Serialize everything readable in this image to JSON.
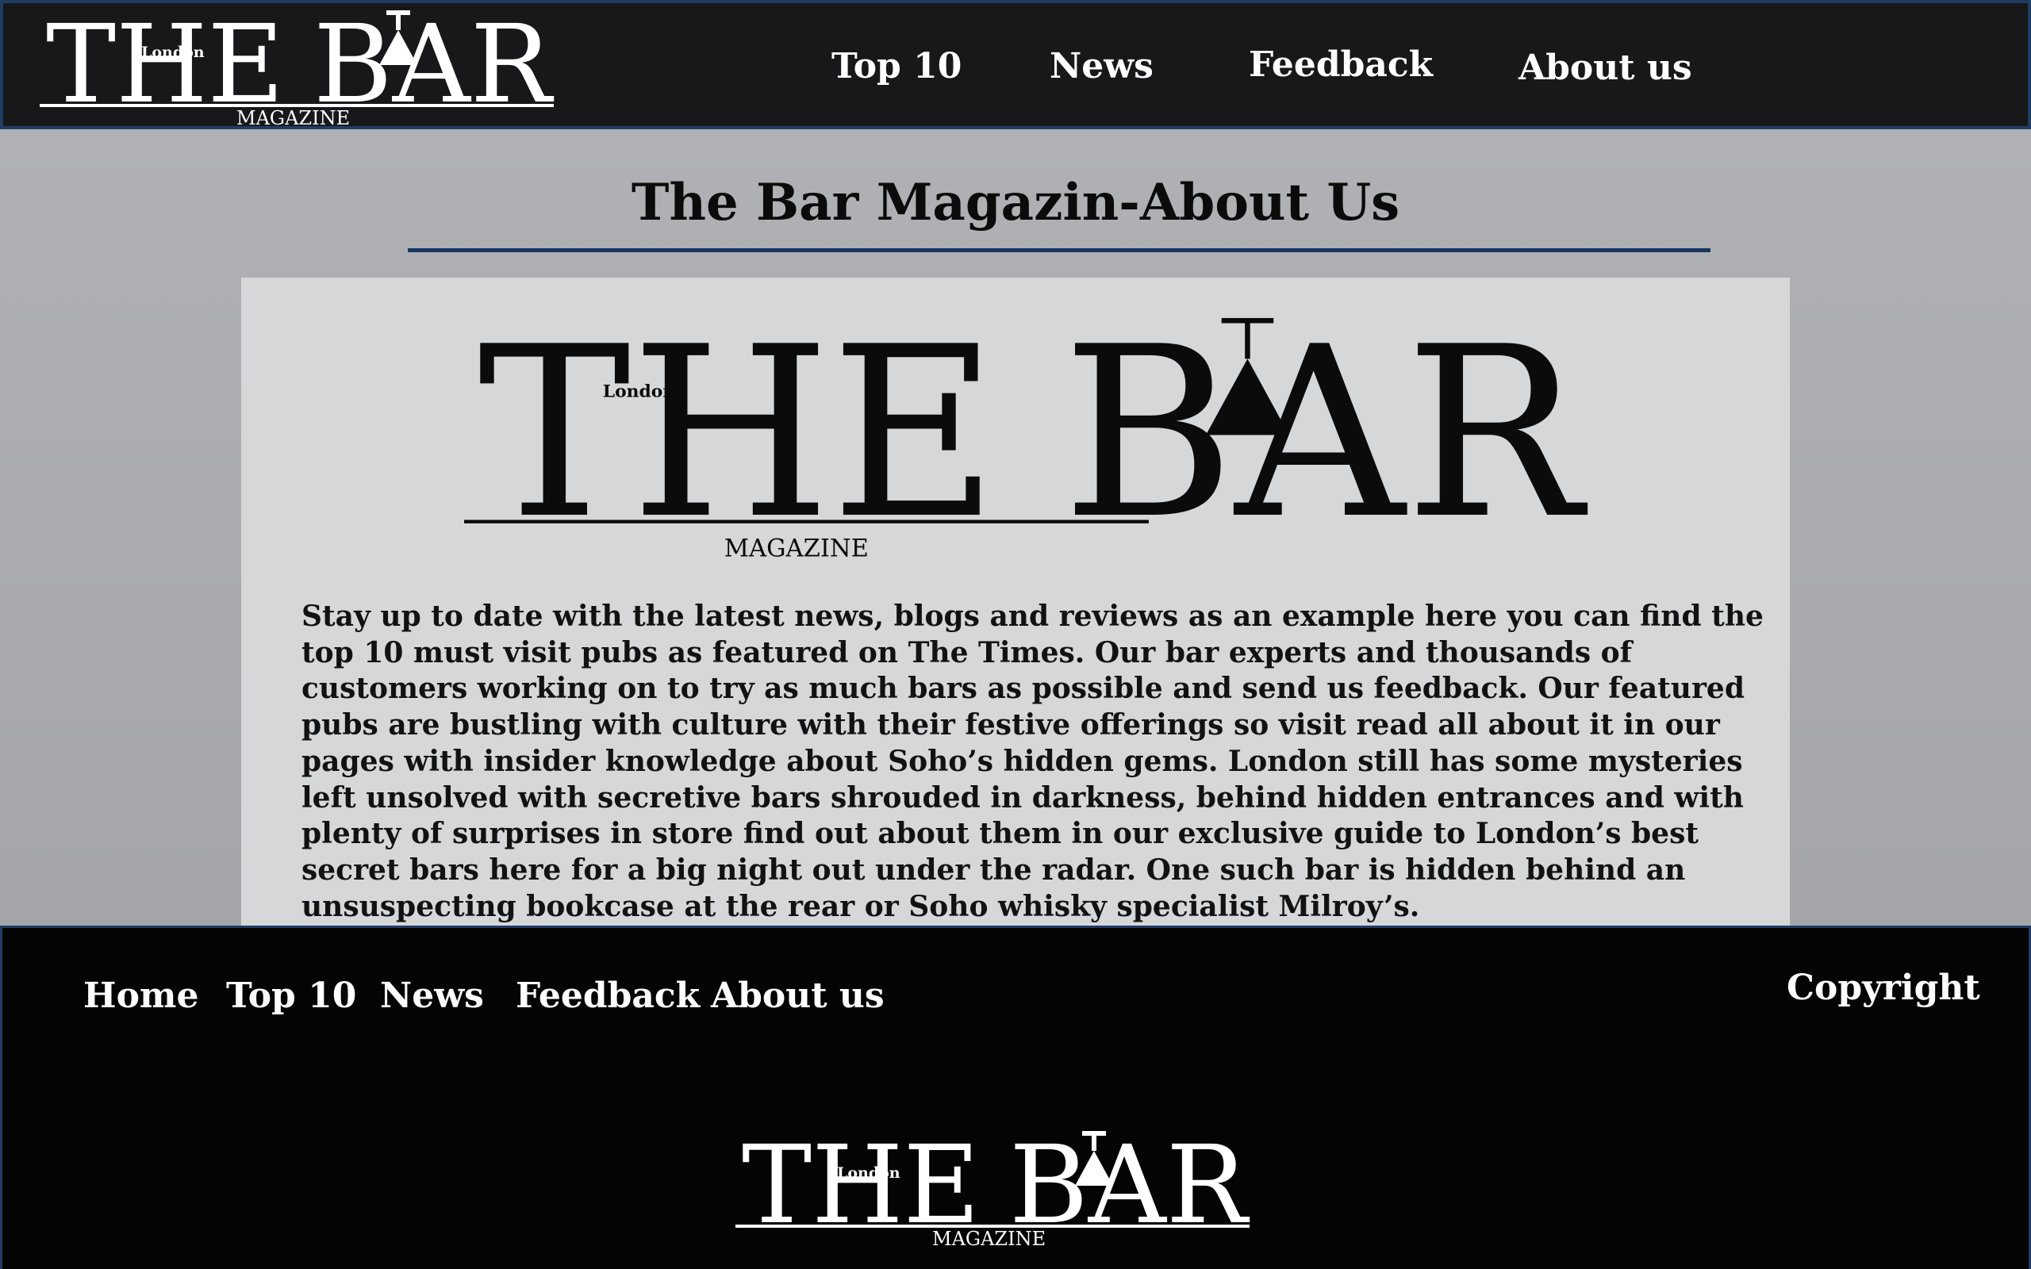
{
  "brand": {
    "name_the": "THE",
    "name_bar": "BAR",
    "tagline_city": "London",
    "tagline_magazine": "MAGAZINE"
  },
  "header": {
    "nav": [
      {
        "label": "Top 10"
      },
      {
        "label": "News"
      },
      {
        "label": "Feedback"
      },
      {
        "label": "About us"
      }
    ]
  },
  "main": {
    "title": "The Bar Magazin-About Us",
    "body": "Stay up to date with the latest news, blogs and reviews as an example here you can find the top 10 must visit pubs as featured on The Times. Our bar experts and thousands of customers working on to try as much bars as possible and send us feedback. Our featured pubs are bustling with culture with their festive offerings so visit read all about it in our pages with insider knowledge about Soho’s hidden gems. London still has some mysteries left unsolved with secretive bars shrouded in darkness, behind hidden entrances and with plenty of surprises in store find out about them in our exclusive guide to London’s best secret bars here for a big night out under the radar. One such bar is hidden behind an unsuspecting bookcase at the rear or Soho whisky specialist Milroy’s."
  },
  "footer": {
    "nav": [
      {
        "label": "Home"
      },
      {
        "label": "Top 10"
      },
      {
        "label": "News"
      },
      {
        "label": "Feedback"
      },
      {
        "label": "About us"
      }
    ],
    "copyright": "Copyright"
  },
  "colors": {
    "header_bg": "#18181a",
    "footer_bg": "#040404",
    "accent_blue": "#1f3d63",
    "page_bg": "#aaabaf",
    "panel_bg": "#d6d7d9"
  }
}
